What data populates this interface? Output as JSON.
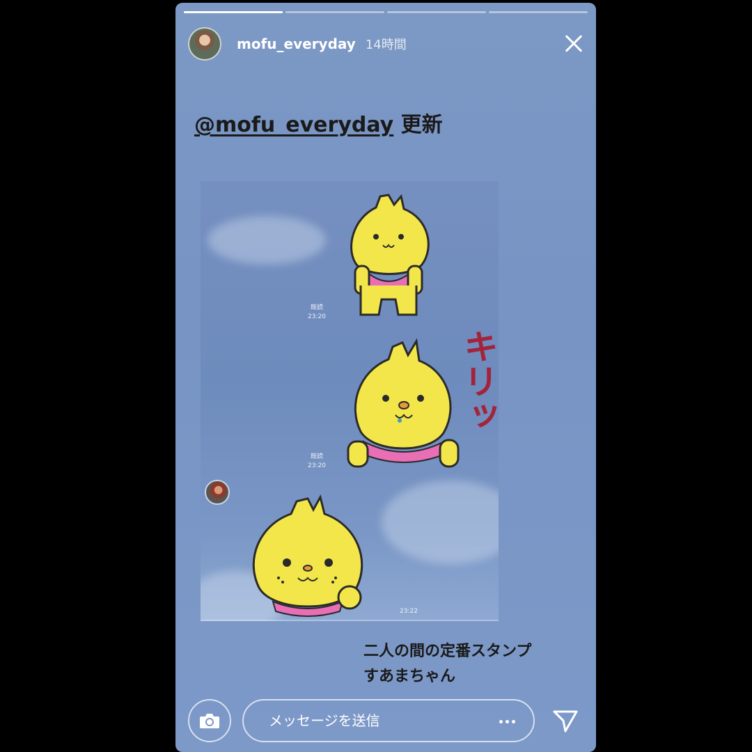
{
  "story": {
    "progress": [
      1.0,
      0.0,
      0.0,
      0.0
    ],
    "header": {
      "username": "mofu_everyday",
      "time_ago": "14時間"
    },
    "caption": {
      "mention": "@mofu_everyday",
      "suffix": " 更新"
    },
    "chat_screenshot": {
      "messages": [
        {
          "read_label": "既読",
          "time": "23:20",
          "sticker": "chick-bib-sticker"
        },
        {
          "read_label": "既読",
          "time": "23:20",
          "sticker": "chick-kiri-sticker",
          "sticker_text": "キリッ"
        },
        {
          "time": "23:22",
          "sticker": "chick-smile-sticker"
        }
      ]
    },
    "note": {
      "line1": "二人の間の定番スタンプ",
      "line2": "すあまちゃん"
    },
    "reply_bar": {
      "placeholder": "メッセージを送信"
    },
    "icons": {
      "close": "close-icon",
      "camera": "camera-icon",
      "more": "more-dots-icon",
      "send": "send-icon"
    },
    "colors": {
      "background": "#7894c4",
      "sticker_yellow": "#f3e64a",
      "bib_pink": "#e86fb6",
      "kiri_text": "#a3243a"
    }
  }
}
